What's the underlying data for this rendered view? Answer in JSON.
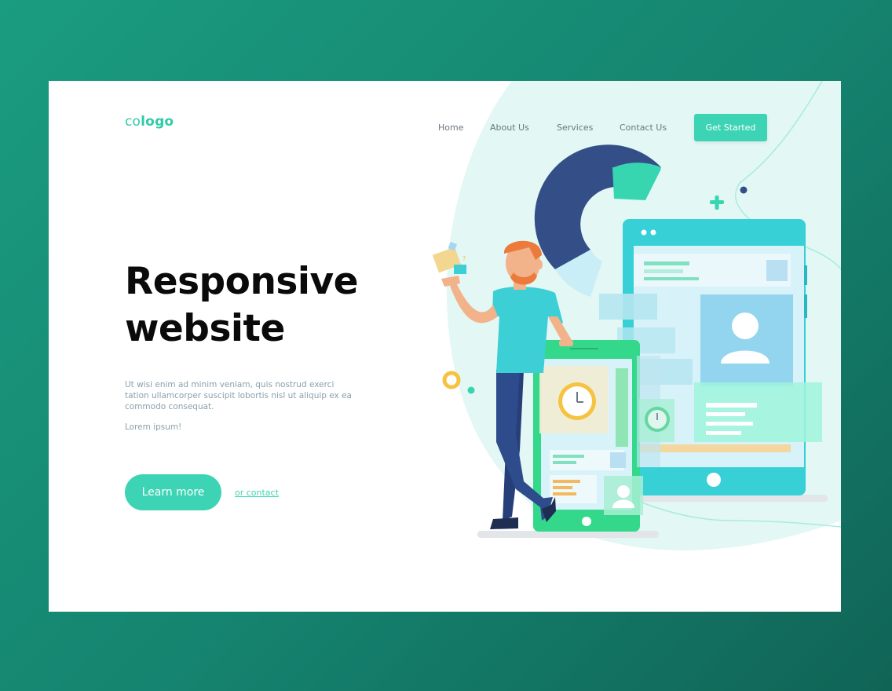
{
  "logo": {
    "prefix": "co",
    "suffix": "logo"
  },
  "nav": {
    "items": [
      "Home",
      "About Us",
      "Services",
      "Contact Us"
    ],
    "cta_label": "Get Started"
  },
  "hero": {
    "title_line1": "Responsive",
    "title_line2": "website",
    "description": "Ut wisi enim ad minim veniam, quis nostrud exerci tation ullamcorper suscipit lobortis nisl ut aliquip ex ea commodo consequat.",
    "subtext": "Lorem ipsum!",
    "primary_button": "Learn more",
    "secondary_link": "or contact"
  },
  "colors": {
    "accent": "#3cd4b4",
    "navy": "#344f87",
    "teal_device": "#37d0d6",
    "green_device": "#34d88b",
    "light_blob": "#e3f7f4",
    "page_bg": "#17907a"
  }
}
